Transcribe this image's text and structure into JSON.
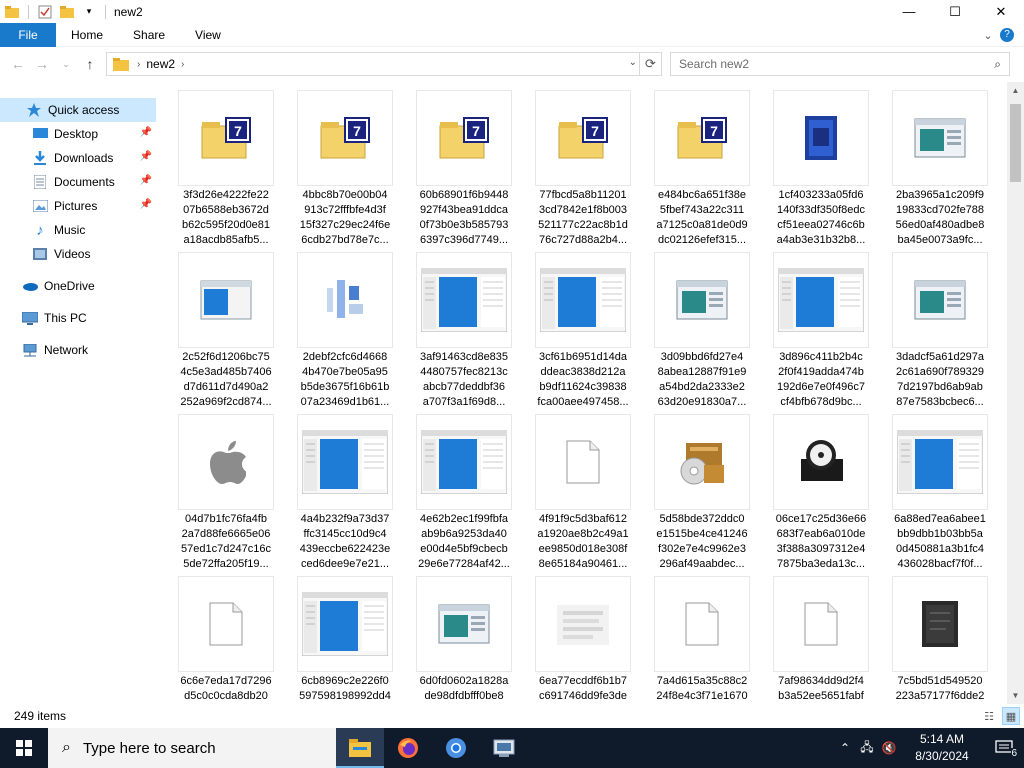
{
  "window": {
    "title": "new2",
    "controls": {
      "minimize": "—",
      "maximize": "☐",
      "close": "✕"
    }
  },
  "ribbon": {
    "tabs": [
      "File",
      "Home",
      "Share",
      "View"
    ]
  },
  "address": {
    "breadcrumb": [
      "new2"
    ],
    "search_placeholder": "Search new2"
  },
  "nav": {
    "items": [
      {
        "label": "Quick access",
        "icon": "star-icon",
        "selected": true,
        "pinned": false
      },
      {
        "label": "Desktop",
        "icon": "desktop-icon",
        "pinned": true
      },
      {
        "label": "Downloads",
        "icon": "download-icon",
        "pinned": true
      },
      {
        "label": "Documents",
        "icon": "documents-icon",
        "pinned": true
      },
      {
        "label": "Pictures",
        "icon": "pictures-icon",
        "pinned": true
      },
      {
        "label": "Music",
        "icon": "music-icon",
        "pinned": false
      },
      {
        "label": "Videos",
        "icon": "videos-icon",
        "pinned": false
      },
      {
        "label": "OneDrive",
        "icon": "cloud-icon",
        "pinned": false
      },
      {
        "label": "This PC",
        "icon": "computer-icon",
        "pinned": false
      },
      {
        "label": "Network",
        "icon": "network-icon",
        "pinned": false
      }
    ]
  },
  "files": [
    {
      "name": "3f3d26e4222fe22\n07b6588eb3672d\nb62c595f20d0e81\na18acdb85afb5...",
      "icon": "folder-7z-icon"
    },
    {
      "name": "4bbc8b70e00b04\n913c72fffbfe4d3f\n15f327c29ec24f6e\n6cdb27bd78e7c...",
      "icon": "folder-7z-icon"
    },
    {
      "name": "60b68901f6b9448\n927f43bea91ddca\n0f73b0e3b585793\n6397c396d7749...",
      "icon": "folder-7z-icon"
    },
    {
      "name": "77fbcd5a8b11201\n3cd7842e1f8b003\n521177c22ac8b1d\n76c727d88a2b4...",
      "icon": "folder-7z-icon"
    },
    {
      "name": "e484bc6a651f38e\n5fbef743a22c311\na7125c0a81de0d9\ndc02126efef315...",
      "icon": "folder-7z-icon"
    },
    {
      "name": "1cf403233a05fd6\n140f33df350f8edc\ncf51eea02746c6b\na4ab3e31b32b8...",
      "icon": "installer-box-icon"
    },
    {
      "name": "2ba3965a1c209f9\n19833cd702fe788\n56ed0af480adbe8\nba45e0073a9fc...",
      "icon": "application-window-icon"
    },
    {
      "name": "2c52f6d1206bc75\n4c5e3ad485b7406\nd7d611d7d490a2\n252a969f2cd874...",
      "icon": "app-blue-window-icon"
    },
    {
      "name": "2debf2cfc6d4668\n4b470e7be05a95\nb5de3675f16b61b\n07a23469d1b61...",
      "icon": "blurred-app-icon"
    },
    {
      "name": "3af91463cd8e835\n4480757fec8213c\nabcb77deddbf36\na707f3a1f69d8...",
      "icon": "explorer-thumbnail-icon"
    },
    {
      "name": "3cf61b6951d14da\nddeac3838d212a\nb9df11624c39838\nfca00aee497458...",
      "icon": "explorer-thumbnail-icon"
    },
    {
      "name": "3d09bbd6fd27e4\n8abea12887f91e9\na54bd2da2333e2\n63d20e91830a7...",
      "icon": "application-window-icon"
    },
    {
      "name": "3d896c411b2b4c\n2f0f419adda474b\n192d6e7e0f496c7\ncf4bfb678d9bc...",
      "icon": "explorer-thumbnail-icon"
    },
    {
      "name": "3dadcf5a61d297a\n2c61a690f789329\n7d2197bd6ab9ab\n87e7583bcbec6...",
      "icon": "application-window-icon"
    },
    {
      "name": "04d7b1fc76fa4fb\n2a7d88fe6665e06\n57ed1c7d247c16c\n5de72ffa205f19...",
      "icon": "apple-logo-icon"
    },
    {
      "name": "4a4b232f9a73d37\nffc3145cc10d9c4\n439eccbe622423e\nced6dee9e7e21...",
      "icon": "explorer-thumbnail-icon"
    },
    {
      "name": "4e62b2ec1f99fbfa\nab9b6a9253da40\ne00d4e5bf9cbecb\n29e6e77284af42...",
      "icon": "explorer-thumbnail-icon"
    },
    {
      "name": "4f91f9c5d3baf612\na1920ae8b2c49a1\nee9850d018e308f\n8e65184a90461...",
      "icon": "blank-file-icon"
    },
    {
      "name": "5d58bde372ddc0\ne1515be4ce41246\nf302e7e4c9962e3\n296af49aabdec...",
      "icon": "disc-box-icon"
    },
    {
      "name": "06ce17c25d36e66\n683f7eab6a010de\n3f388a3097312e4\n7875ba3eda13c...",
      "icon": "disc-drive-icon"
    },
    {
      "name": "6a88ed7ea6abee1\nbb9dbb1b03bb5a\n0d450881a3b1fc4\n436028bacf7f0f...",
      "icon": "explorer-thumbnail-icon"
    },
    {
      "name": "6c6e7eda17d7296\nd5c0c0cda8db20",
      "icon": "blank-file-icon"
    },
    {
      "name": "6cb8969c2e226f0\n597598198992dd4",
      "icon": "explorer-thumbnail-icon"
    },
    {
      "name": "6d0fd0602a1828a\nde98dfdbfff0be8",
      "icon": "application-window-icon"
    },
    {
      "name": "6ea77ecddf6b1b7\nc691746dd9fe3de",
      "icon": "blurred-doc-icon"
    },
    {
      "name": "7a4d615a35c88c2\n24f8e4c3f71e1670",
      "icon": "blank-file-icon"
    },
    {
      "name": "7af98634dd9d2f4\nb3a52ee5651fabf",
      "icon": "blank-file-icon"
    },
    {
      "name": "7c5bd51d549520\n223a57177f6dde2",
      "icon": "dark-archive-icon"
    }
  ],
  "status": {
    "item_count": "249 items"
  },
  "taskbar": {
    "search_placeholder": "Type here to search",
    "apps": [
      "file-explorer-icon",
      "firefox-icon",
      "chrome-icon",
      "network-app-icon"
    ],
    "time": "5:14 AM",
    "date": "8/30/2024",
    "notification_count": "6"
  },
  "colors": {
    "accent": "#1979ca",
    "selection": "#cce8ff",
    "taskbar": "#0f1a2b"
  }
}
